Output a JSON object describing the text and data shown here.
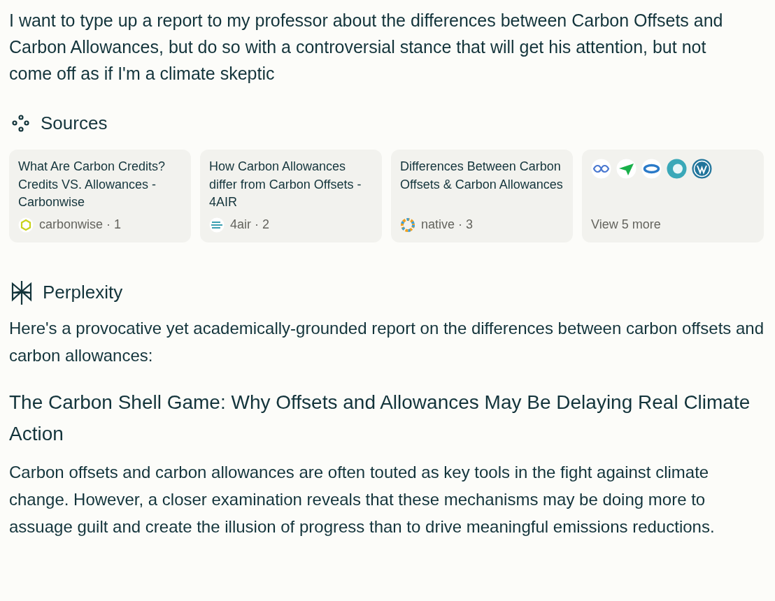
{
  "query": "I want to type up a report to my professor about the differences between Carbon Offsets and Carbon Allowances, but do so with a controversial stance that will get his attention, but not come off as if I'm a climate skeptic",
  "sources": {
    "heading": "Sources",
    "items": [
      {
        "title": "What Are Carbon Credits? Credits VS. Allowances - Carbonwise",
        "site": "carbonwise · 1"
      },
      {
        "title": "How Carbon Allowances differ from Carbon Offsets - 4AIR",
        "site": "4air · 2"
      },
      {
        "title": "Differences Between Carbon Offsets & Carbon Allowances",
        "site": "native · 3"
      }
    ],
    "more": {
      "label": "View 5 more"
    }
  },
  "answer": {
    "heading": "Perplexity",
    "intro": "Here's a provocative yet academically-grounded report on the differences between carbon offsets and carbon allowances:",
    "title": "The Carbon Shell Game: Why Offsets and Allowances May Be Delaying Real Climate Action",
    "paragraph": "Carbon offsets and carbon allowances are often touted as key tools in the fight against climate change. However, a closer examination reveals that these mechanisms may be doing more to assuage guilt and create the illusion of progress than to drive meaningful emissions reductions."
  }
}
